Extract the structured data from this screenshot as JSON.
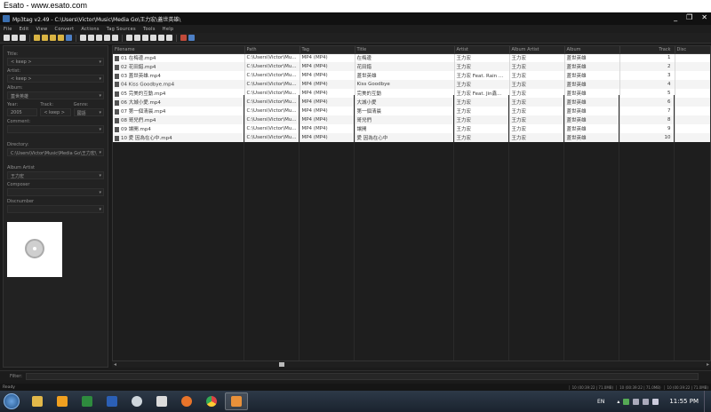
{
  "banner": "Esato - www.esato.com",
  "window": {
    "title": "Mp3tag v2.49  -  C:\\Users\\Victor\\Music\\Media Go\\王力宏\\蓋世英雄\\",
    "minimize": "_",
    "maximize": "❐",
    "close": "✕"
  },
  "menu": [
    "File",
    "Edit",
    "View",
    "Convert",
    "Actions",
    "Tag Sources",
    "Tools",
    "Help"
  ],
  "left": {
    "title_label": "Title:",
    "title_value": "< keep >",
    "artist_label": "Artist:",
    "artist_value": "< keep >",
    "album_label": "Album:",
    "album_value": "蓋世英雄",
    "year_label": "Year:",
    "year_value": "2005",
    "track_label": "Track:",
    "track_value": "< keep >",
    "genre_label": "Genre:",
    "genre_value": "國語",
    "comment_label": "Comment:",
    "comment_value": "",
    "directory_label": "Directory:",
    "directory_value": "C:\\Users\\Victor\\Music\\Media Go\\王力宏\\",
    "album_artist_label": "Album Artist",
    "album_artist_value": "王力宏",
    "composer_label": "Composer",
    "composer_value": "",
    "discnumber_label": "Discnumber",
    "discnumber_value": ""
  },
  "table": {
    "headers": [
      "Filename",
      "Path",
      "Tag",
      "Title",
      "Artist",
      "Album Artist",
      "Album",
      "Track",
      "Disc"
    ],
    "rows": [
      [
        "01 在梅邊.mp4",
        "C:\\Users\\Victor\\Mu...",
        "MP4 (MP4)",
        "在梅邊",
        "王力宏",
        "王力宏",
        "蓋世英雄",
        "1"
      ],
      [
        "02 花田錯.mp4",
        "C:\\Users\\Victor\\Mu...",
        "MP4 (MP4)",
        "花田錯",
        "王力宏",
        "王力宏",
        "蓋世英雄",
        "2"
      ],
      [
        "03 蓋世英雄.mp4",
        "C:\\Users\\Victor\\Mu...",
        "MP4 (MP4)",
        "蓋世英雄",
        "王力宏 Feat. Rain ...",
        "王力宏",
        "蓋世英雄",
        "3"
      ],
      [
        "04 Kiss Goodbye.mp4",
        "C:\\Users\\Victor\\Mu...",
        "MP4 (MP4)",
        "Kiss Goodbye",
        "王力宏",
        "王力宏",
        "蓋世英雄",
        "4"
      ],
      [
        "05 完美的互動.mp4",
        "C:\\Users\\Victor\\Mu...",
        "MP4 (MP4)",
        "完美的互動",
        "王力宏 Feat. Jin鑫...",
        "王力宏",
        "蓋世英雄",
        "5"
      ],
      [
        "06 大城小愛.mp4",
        "C:\\Users\\Victor\\Mu...",
        "MP4 (MP4)",
        "大城小愛",
        "王力宏",
        "王力宏",
        "蓋世英雄",
        "6"
      ],
      [
        "07 第一個清晨.mp4",
        "C:\\Users\\Victor\\Mu...",
        "MP4 (MP4)",
        "第一個清晨",
        "王力宏",
        "王力宏",
        "蓋世英雄",
        "7"
      ],
      [
        "08 哥兒們.mp4",
        "C:\\Users\\Victor\\Mu...",
        "MP4 (MP4)",
        "哥兒們",
        "王力宏",
        "王力宏",
        "蓋世英雄",
        "8"
      ],
      [
        "09 讓開.mp4",
        "C:\\Users\\Victor\\Mu...",
        "MP4 (MP4)",
        "讓開",
        "王力宏",
        "王力宏",
        "蓋世英雄",
        "9"
      ],
      [
        "10 愛 因為在心中.mp4",
        "C:\\Users\\Victor\\Mu...",
        "MP4 (MP4)",
        "愛 因為在心中",
        "王力宏",
        "王力宏",
        "蓋世英雄",
        "10"
      ]
    ]
  },
  "filter": {
    "label": "Filter:",
    "value": ""
  },
  "status": {
    "text": "Ready",
    "count1": "10 (00:39:22 | 71.0MB)",
    "count2": "10 (00:39:22 | 71.0MB)",
    "count3": "10 (00:39:22 | 71.0MB)"
  },
  "taskbar": {
    "language": "EN",
    "time": "11:55 PM",
    "apps": [
      "explorer-icon",
      "media-player-icon",
      "excel-icon",
      "word-icon",
      "steam-icon",
      "printer-icon",
      "app-3-icon",
      "chrome-icon",
      "mp3tag-icon"
    ]
  }
}
